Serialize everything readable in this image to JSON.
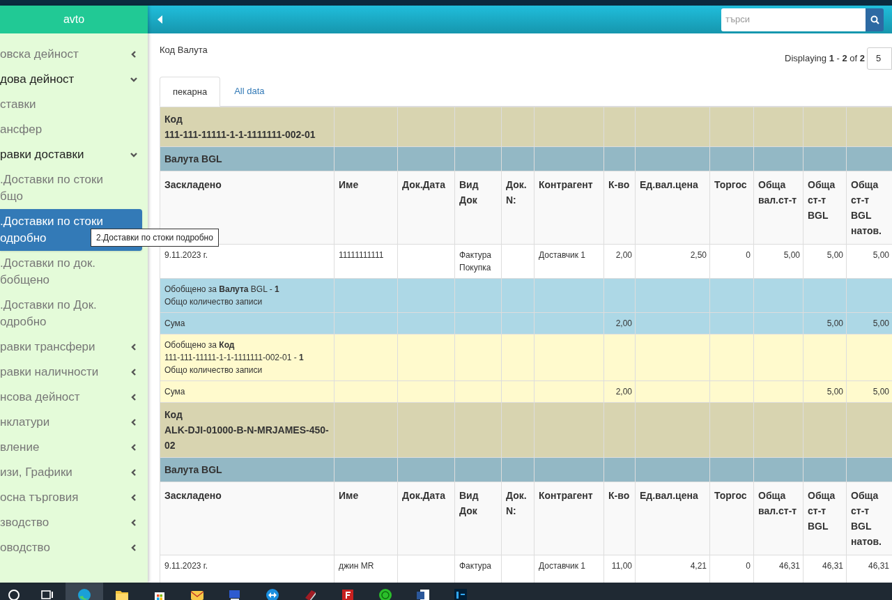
{
  "sidebar": {
    "title": "avto",
    "items": [
      {
        "lines": [
          "овска дейност"
        ],
        "expanded": false
      },
      {
        "lines": [
          "дова дейност"
        ],
        "expanded": true,
        "children": [
          {
            "lines": [
              "ставки"
            ]
          },
          {
            "lines": [
              "ансфер"
            ]
          },
          {
            "lines": [
              "равки доставки"
            ],
            "expanded": true,
            "children": [
              {
                "lines": [
                  ".Доставки по стоки",
                  "бщо"
                ],
                "selected": false
              },
              {
                "lines": [
                  ".Доставки по стоки",
                  "одробно"
                ],
                "selected": true
              },
              {
                "lines": [
                  ".Доставки по док.",
                  "бобщено"
                ],
                "selected": false
              },
              {
                "lines": [
                  ".Доставки по Док.",
                  "одробно"
                ],
                "selected": false
              }
            ]
          },
          {
            "lines": [
              "равки трансфери"
            ],
            "expanded": false
          },
          {
            "lines": [
              "равки наличности"
            ],
            "expanded": false
          }
        ]
      },
      {
        "lines": [
          "нсова дейност"
        ],
        "expanded": false
      },
      {
        "lines": [
          "нклатури"
        ],
        "expanded": false
      },
      {
        "lines": [
          "вление"
        ],
        "expanded": false
      },
      {
        "lines": [
          "изи, Графики"
        ],
        "expanded": false
      },
      {
        "lines": [
          "осна търговия"
        ],
        "expanded": false
      },
      {
        "lines": [
          "зводство"
        ],
        "expanded": false
      },
      {
        "lines": [
          "оводство"
        ],
        "expanded": false
      }
    ]
  },
  "tooltip": "2.Доставки по стоки подробно",
  "search": {
    "placeholder": "търси"
  },
  "report_title": "Код Валута",
  "pagination": {
    "text": "Displaying **1** - **2** of **2**",
    "page_size": "5"
  },
  "tabs": [
    {
      "label": "пекарна",
      "selected": true
    },
    {
      "label": "All data",
      "selected": false
    }
  ],
  "table": {
    "rows": [
      {
        "kind": "group",
        "label": "Код",
        "value": "111-111-11111-1-1-1111111-002-01"
      },
      {
        "kind": "subgroup",
        "text": "Валута BGL"
      },
      {
        "kind": "header",
        "cells": [
          "Заскладено",
          "Име",
          "Док.Дата",
          "Вид Док",
          "Док. N:",
          "Контрагент",
          "К-во",
          "Ед.вал.цена",
          "Торгос",
          "Обща вал.ст-т",
          "Обща ст-т BGL",
          "Обща ст-т BGL натов."
        ]
      },
      {
        "kind": "data",
        "cells": [
          "9.11.2023 г.",
          "11111111111",
          null,
          "Фактура Покупка",
          null,
          "Доставчик 1",
          "2,00",
          "2,50",
          "0",
          "5,00",
          "5,00",
          "5,00"
        ]
      },
      {
        "kind": "subgroup_summary",
        "lines": [
          "Обобщено за **Валута** BGL  - **1**",
          "Общо количество записи"
        ]
      },
      {
        "kind": "subgroup_sum",
        "cells": [
          "Сума",
          null,
          null,
          null,
          null,
          null,
          "2,00",
          null,
          null,
          null,
          "5,00",
          "5,00"
        ]
      },
      {
        "kind": "group_summary",
        "lines": [
          "Обобщено за **Код**",
          "111-111-11111-1-1-1111111-002-01  - **1**",
          "Общо количество записи"
        ]
      },
      {
        "kind": "group_sum",
        "cells": [
          "Сума",
          null,
          null,
          null,
          null,
          null,
          "2,00",
          null,
          null,
          null,
          "5,00",
          "5,00"
        ]
      },
      {
        "kind": "group",
        "label": "Код",
        "value": "ALK-DJI-01000-B-N-MRJAMES-450-02"
      },
      {
        "kind": "subgroup",
        "text": "Валута BGL"
      },
      {
        "kind": "header",
        "cells": [
          "Заскладено",
          "Име",
          "Док.Дата",
          "Вид Док",
          "Док. N:",
          "Контрагент",
          "К-во",
          "Ед.вал.цена",
          "Торгос",
          "Обща вал.ст-т",
          "Обща ст-т BGL",
          "Обща ст-т BGL натов."
        ]
      },
      {
        "kind": "data",
        "cells": [
          "9.11.2023 г.",
          "джин MR",
          null,
          "Фактура",
          null,
          "Доставчик 1",
          "11,00",
          "4,21",
          "0",
          "46,31",
          "46,31",
          "46,31"
        ]
      }
    ]
  },
  "taskbar": {
    "items": [
      {
        "kind": "search",
        "selected": false
      },
      {
        "kind": "task-view",
        "selected": false
      },
      {
        "kind": "browser",
        "selected": true
      },
      {
        "kind": "folder",
        "selected": false
      },
      {
        "kind": "store",
        "selected": false
      },
      {
        "kind": "mail",
        "selected": false
      },
      {
        "kind": "monitor",
        "selected": false
      },
      {
        "kind": "remote",
        "selected": false
      },
      {
        "kind": "book",
        "selected": false
      },
      {
        "kind": "ftp",
        "selected": false
      },
      {
        "kind": "chat",
        "selected": false
      },
      {
        "kind": "word",
        "selected": false
      },
      {
        "kind": "photoshop",
        "selected": false
      }
    ]
  }
}
